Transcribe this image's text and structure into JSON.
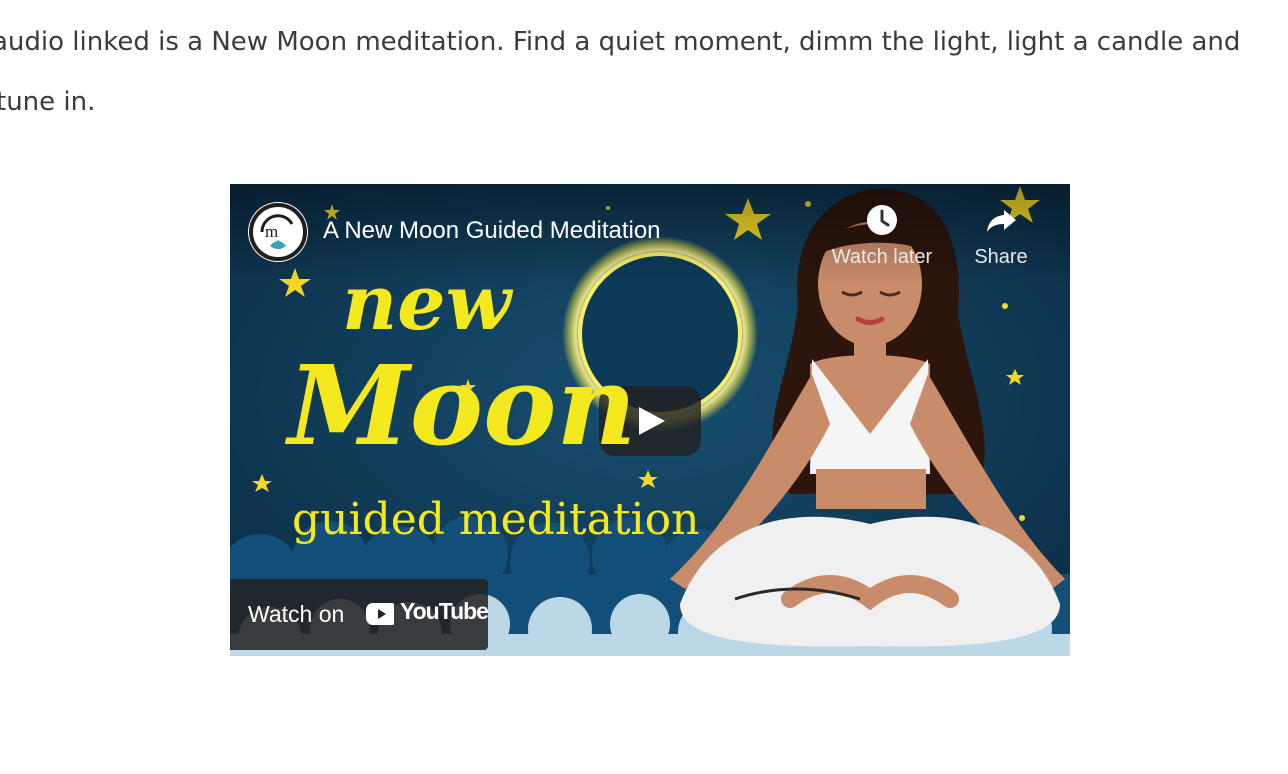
{
  "article": {
    "line1": "audio linked is a New Moon meditation. Find a quiet moment, dimm the light, light a candle and",
    "line2": "tune in."
  },
  "video": {
    "title": "A New Moon Guided Meditation",
    "channel_avatar": "mt-lotus-logo",
    "thumbnail_text": {
      "word1": "new",
      "word2": "Moon",
      "word3": "guided meditation"
    },
    "watch_later_label": "Watch later",
    "share_label": "Share",
    "watch_on_label": "Watch on",
    "youtube_word": "YouTube",
    "icons": [
      "clock-icon",
      "share-arrow-icon",
      "play-icon",
      "youtube-logo-icon"
    ],
    "colors": {
      "sky": "#0e3350",
      "text_yellow": "#f4e81f",
      "star": "#f2d925",
      "youtube_red": "#ffffff"
    }
  }
}
